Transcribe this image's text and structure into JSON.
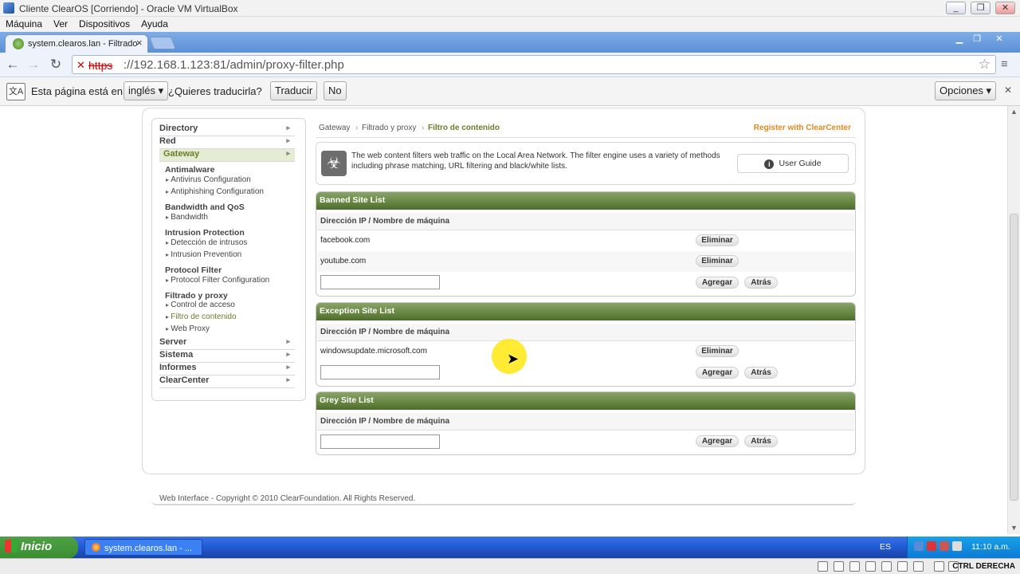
{
  "vbox": {
    "title": "Cliente ClearOS [Corriendo] - Oracle VM VirtualBox",
    "menu": [
      "Máquina",
      "Ver",
      "Dispositivos",
      "Ayuda"
    ]
  },
  "browser": {
    "tab_title": "system.clearos.lan - Filtrado",
    "url_scheme": "https",
    "url_rest": "://192.168.1.123:81/admin/proxy-filter.php"
  },
  "translate_bar": {
    "prefix": "Esta página está en",
    "language": "inglés",
    "question": "¿Quieres traducirla?",
    "translate_btn": "Traducir",
    "no_btn": "No",
    "options_btn": "Opciones"
  },
  "sidebar": {
    "sections": {
      "directory": "Directory",
      "red": "Red",
      "gateway": "Gateway",
      "server": "Server",
      "sistema": "Sistema",
      "informes": "Informes",
      "clearcenter": "ClearCenter"
    },
    "groups": {
      "antimalware": "Antimalware",
      "antivirus": "Antivirus Configuration",
      "antiphishing": "Antiphishing Configuration",
      "bandwidth_qos": "Bandwidth and QoS",
      "bandwidth": "Bandwidth",
      "intrusion_protection": "Intrusion Protection",
      "deteccion": "Detección de intrusos",
      "prevention": "Intrusion Prevention",
      "protocol_filter": "Protocol Filter",
      "protocol_filter_conf": "Protocol Filter Configuration",
      "filtrado_proxy": "Filtrado y proxy",
      "control_acceso": "Control de acceso",
      "filtro_contenido": "Filtro de contenido",
      "web_proxy": "Web Proxy"
    }
  },
  "breadcrumb": {
    "items": [
      "Gateway",
      "Filtrado y proxy"
    ],
    "current": "Filtro de contenido",
    "register": "Register with ClearCenter"
  },
  "info": {
    "text": "The web content filters web traffic on the Local Area Network. The filter engine uses a variety of methods including phrase matching, URL filtering and black/white lists.",
    "guide_btn": "User Guide"
  },
  "labels": {
    "column": "Dirección IP / Nombre de máquina",
    "delete": "Eliminar",
    "add": "Agregar",
    "back": "Atrás"
  },
  "banned": {
    "title": "Banned Site List",
    "entries": [
      "facebook.com",
      "youtube.com"
    ]
  },
  "exception": {
    "title": "Exception Site List",
    "entries": [
      "windowsupdate.microsoft.com"
    ]
  },
  "grey": {
    "title": "Grey Site List",
    "entries": []
  },
  "footer": "Web Interface - Copyright © 2010 ClearFoundation. All Rights Reserved.",
  "taskbar": {
    "start": "Inicio",
    "task": "system.clearos.lan - ...",
    "lang": "ES",
    "clock": "11:10 a.m."
  },
  "host_key": "CTRL DERECHA",
  "colors": {
    "accent_green": "#5f7f3a",
    "register_orange": "#e08a1e"
  }
}
